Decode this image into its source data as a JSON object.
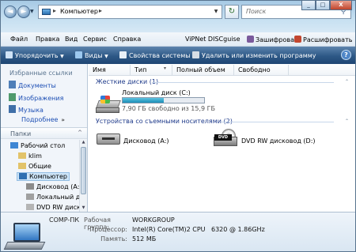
{
  "address": {
    "path": "Компьютер",
    "search_placeholder": "Поиск"
  },
  "window_buttons": {
    "minimize": "_",
    "maximize": "□",
    "close": "X"
  },
  "menu": {
    "items": [
      "Файл",
      "Правка",
      "Вид",
      "Сервис",
      "Справка"
    ],
    "vipnet": "ViPNet DISCguise",
    "encrypt": "Зашифровать",
    "decrypt": "Расшифровать"
  },
  "command_bar": {
    "organize": "Упорядочить",
    "views": "Виды",
    "system_properties": "Свойства системы",
    "uninstall": "Удалить или изменить программу",
    "dropdown_glyph": "▼",
    "help_glyph": "?"
  },
  "sidebar": {
    "favorites_title": "Избранные ссылки",
    "favorites": [
      "Документы",
      "Изображения",
      "Музыка"
    ],
    "more": "Подробнее",
    "more_glyph": "»",
    "folders_title": "Папки",
    "folders_glyph": "^",
    "tree": [
      "Рабочий стол",
      "klim",
      "Общие",
      "Компьютер",
      "Дисковод (A:)",
      "Локальный ди",
      "DVD RW дисков"
    ]
  },
  "columns": [
    "Имя",
    "Тип",
    "Полный объем",
    "Свободно"
  ],
  "groups": {
    "hard_drives": "Жесткие диски (1)",
    "removable": "Устройства со съемными носителями (2)"
  },
  "local_disk": {
    "name": "Локальный диск (C:)",
    "free_text": "7,90 ГБ свободно из 15,9 ГБ",
    "used_fraction": 0.5
  },
  "removable_devices": [
    "Дисковод (A:)",
    "DVD RW дисковод (D:)"
  ],
  "details": {
    "computer_name": "COMP-ПК",
    "workgroup_label": "Рабочая группа:",
    "workgroup_value": "WORKGROUP",
    "cpu_label": "Процессор:",
    "cpu_value": "Intel(R) Core(TM)2 CPU",
    "cpu_model": "6320",
    "cpu_speed": "@ 1.86GHz",
    "memory_label": "Память:",
    "memory_value": "512 МБ"
  },
  "colors": {
    "command_bar": "#2d5886",
    "link": "#1d4fb4",
    "group_header": "#1e3a8a",
    "progress": "#1a8fb8"
  }
}
